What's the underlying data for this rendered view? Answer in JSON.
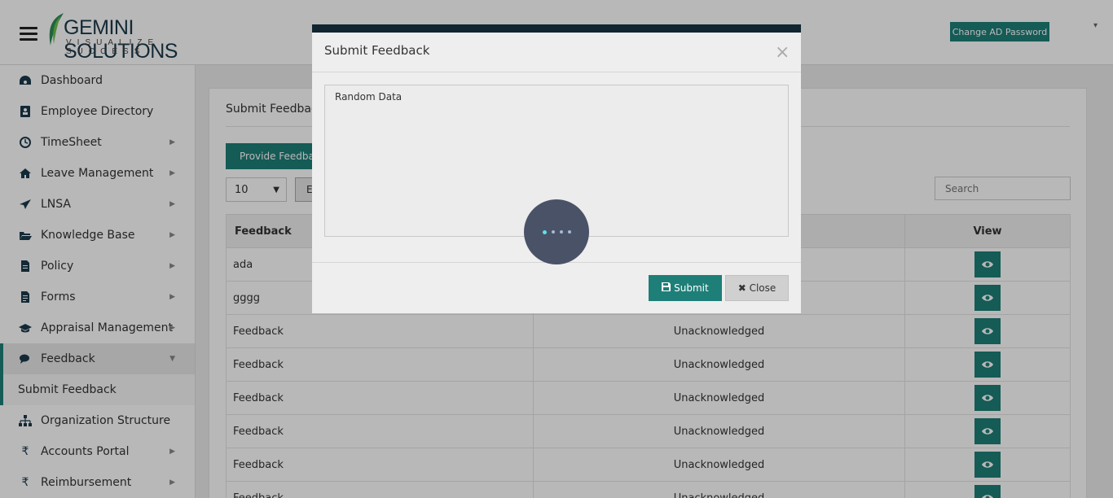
{
  "header": {
    "logo_brand": "GEMINI SOLUTIONS",
    "logo_tagline": "VISUALIZE SUCCESS",
    "change_password_label": "Change AD Password",
    "user_caret": "▾"
  },
  "sidebar": {
    "items": [
      {
        "label": "Dashboard",
        "icon": "dashboard-icon"
      },
      {
        "label": "Employee Directory",
        "icon": "contact-card-icon"
      },
      {
        "label": "TimeSheet",
        "icon": "clock-icon"
      },
      {
        "label": "Leave Management",
        "icon": "home-icon"
      },
      {
        "label": "LNSA",
        "icon": "paper-plane-icon"
      },
      {
        "label": "Knowledge Base",
        "icon": "folder-open-icon"
      },
      {
        "label": "Policy",
        "icon": "document-icon"
      },
      {
        "label": "Forms",
        "icon": "form-icon"
      },
      {
        "label": "Appraisal Management",
        "icon": "graduation-cap-icon"
      },
      {
        "label": "Feedback",
        "icon": "comments-icon"
      },
      {
        "label": "Submit Feedback"
      },
      {
        "label": "Organization Structure",
        "icon": "sitemap-icon"
      },
      {
        "label": "Accounts Portal",
        "icon": "rupee-icon"
      },
      {
        "label": "Reimbursement",
        "icon": "rupee-icon"
      }
    ]
  },
  "content": {
    "title": "Submit Feedback",
    "provide_button": "Provide Feedback",
    "page_length": "10",
    "export_button": "E",
    "search_placeholder": "Search",
    "columns": [
      "Feedback",
      "",
      "View"
    ],
    "rows": [
      {
        "feedback": "ada",
        "status": ""
      },
      {
        "feedback": "gggg",
        "status": ""
      },
      {
        "feedback": "Feedback",
        "status": "Unacknowledged"
      },
      {
        "feedback": "Feedback",
        "status": "Unacknowledged"
      },
      {
        "feedback": "Feedback",
        "status": "Unacknowledged"
      },
      {
        "feedback": "Feedback",
        "status": "Unacknowledged"
      },
      {
        "feedback": "Feedback",
        "status": "Unacknowledged"
      },
      {
        "feedback": "Feedback",
        "status": "Unacknowledged"
      }
    ]
  },
  "modal": {
    "title": "Submit Feedback",
    "close_x": "×",
    "text_value": "Random Data",
    "submit_label": "Submit",
    "close_label": "Close"
  },
  "colors": {
    "accent": "#1e7f78",
    "modal_top": "#102530",
    "spinner_bg": "#4a5268",
    "spinner_dot": "#5fe0e8"
  }
}
